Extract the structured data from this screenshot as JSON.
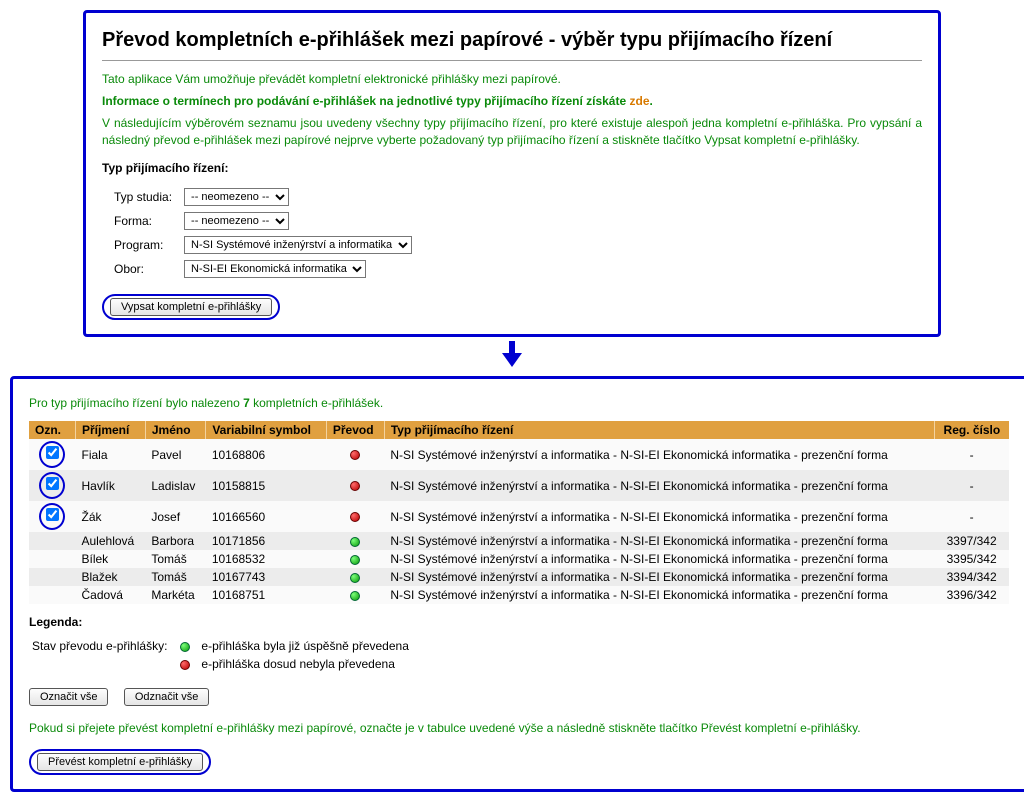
{
  "top": {
    "title": "Převod kompletních e-přihlášek mezi papírové - výběr typu přijímacího řízení",
    "intro1": "Tato aplikace Vám umožňuje převádět kompletní elektronické přihlášky mezi papírové.",
    "intro2_pre": "Informace o termínech pro podávání e-přihlášek na jednotlivé typy přijímacího řízení získáte ",
    "intro2_link": "zde",
    "intro2_post": ".",
    "intro3": "V následujícím výběrovém seznamu jsou uvedeny všechny typy přijímacího řízení, pro které existuje alespoň jedna kompletní e-přihláška. Pro vypsání a následný převod e-přihlášek mezi papírové nejprve vyberte požadovaný typ přijímacího řízení a stiskněte tlačítko Vypsat kompletní e-přihlášky.",
    "section_head": "Typ přijímacího řízení:",
    "filters": {
      "study_label": "Typ studia:",
      "study_value": "-- neomezeno --",
      "form_label": "Forma:",
      "form_value": "-- neomezeno --",
      "program_label": "Program:",
      "program_value": "N-SI Systémové inženýrství a informatika",
      "field_label": "Obor:",
      "field_value": "N-SI-EI Ekonomická informatika"
    },
    "submit_label": "Vypsat kompletní e-přihlášky"
  },
  "bottom": {
    "found_pre": "Pro typ přijímacího řízení bylo nalezeno ",
    "found_count": "7",
    "found_post": " kompletních e-přihlášek.",
    "headers": {
      "ozn": "Ozn.",
      "prijmeni": "Příjmení",
      "jmeno": "Jméno",
      "varsymbol": "Variabilní symbol",
      "prevod": "Převod",
      "typ": "Typ přijímacího řízení",
      "reg": "Reg. číslo"
    },
    "type_full": "N-SI Systémové inženýrství a informatika - N-SI-EI Ekonomická informatika - prezenční forma",
    "rows": [
      {
        "checked": true,
        "surname": "Fiala",
        "name": "Pavel",
        "vs": "10168806",
        "status": "red",
        "reg": "-"
      },
      {
        "checked": true,
        "surname": "Havlík",
        "name": "Ladislav",
        "vs": "10158815",
        "status": "red",
        "reg": "-"
      },
      {
        "checked": true,
        "surname": "Žák",
        "name": "Josef",
        "vs": "10166560",
        "status": "red",
        "reg": "-"
      },
      {
        "checked": false,
        "surname": "Aulehlová",
        "name": "Barbora",
        "vs": "10171856",
        "status": "green",
        "reg": "3397/342"
      },
      {
        "checked": false,
        "surname": "Bílek",
        "name": "Tomáš",
        "vs": "10168532",
        "status": "green",
        "reg": "3395/342"
      },
      {
        "checked": false,
        "surname": "Blažek",
        "name": "Tomáš",
        "vs": "10167743",
        "status": "green",
        "reg": "3394/342"
      },
      {
        "checked": false,
        "surname": "Čadová",
        "name": "Markéta",
        "vs": "10168751",
        "status": "green",
        "reg": "3396/342"
      }
    ],
    "legend": {
      "head": "Legenda:",
      "state_label": "Stav převodu e-přihlášky:",
      "green_text": "e-přihláška byla již úspěšně převedena",
      "red_text": "e-přihláška dosud nebyla převedena"
    },
    "check_all": "Označit vše",
    "uncheck_all": "Odznačit vše",
    "hint": "Pokud si přejete převést kompletní e-přihlášky mezi papírové, označte je v tabulce uvedené výše a následně stiskněte tlačítko Převést kompletní e-přihlášky.",
    "convert_label": "Převést kompletní e-přihlášky"
  }
}
